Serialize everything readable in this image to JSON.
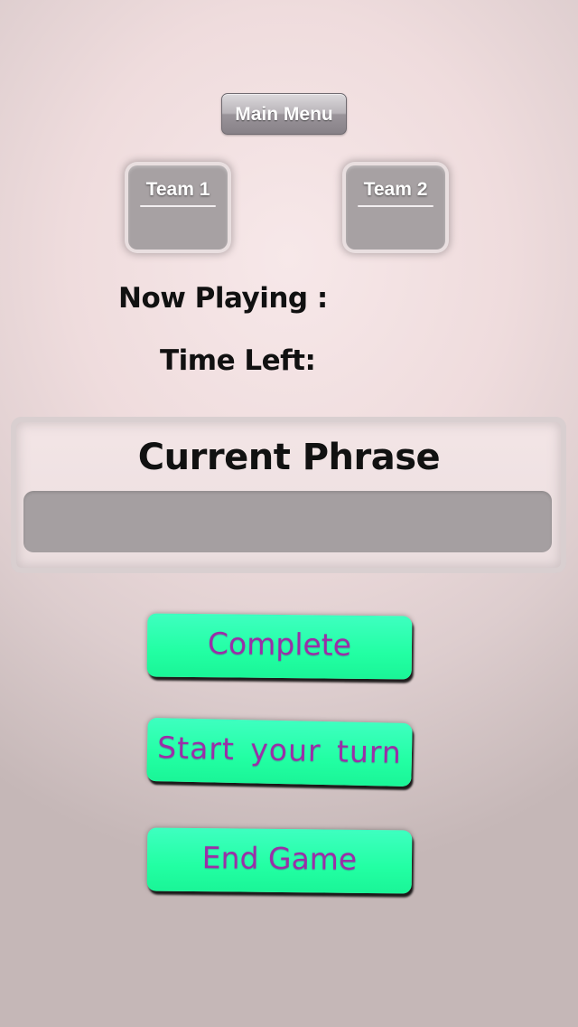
{
  "header": {
    "main_menu_label": "Main Menu"
  },
  "teams": [
    {
      "label": "Team 1"
    },
    {
      "label": "Team 2"
    }
  ],
  "status": {
    "now_playing_label": "Now Playing :",
    "time_left_label": "Time Left:"
  },
  "phrase": {
    "title": "Current Phrase",
    "value": ""
  },
  "actions": {
    "complete_label": "Complete",
    "start_turn_label": "Start  your  turn",
    "end_game_label": "End Game"
  },
  "colors": {
    "action_button": "#22ffa3",
    "action_text": "#9a2fa7",
    "team_tile": "#a7a1a3",
    "phrase_field": "#a59fa1"
  }
}
